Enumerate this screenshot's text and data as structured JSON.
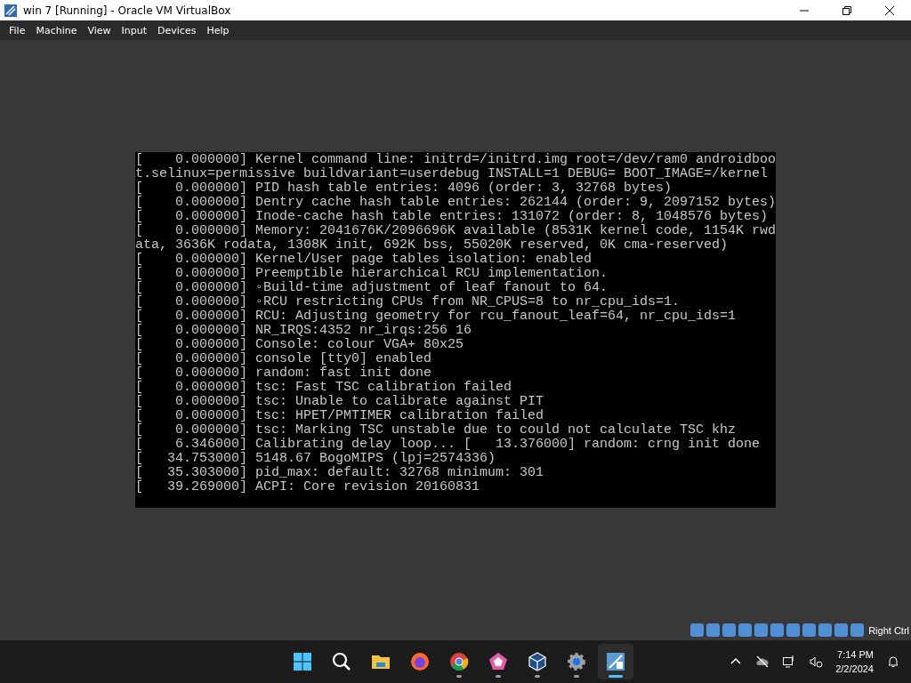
{
  "window": {
    "title": "win 7 [Running] - Oracle VM VirtualBox"
  },
  "menu": [
    "File",
    "Machine",
    "View",
    "Input",
    "Devices",
    "Help"
  ],
  "console": {
    "lines": [
      "[    0.000000] Kernel command line: initrd=/initrd.img root=/dev/ram0 androidboo",
      "t.selinux=permissive buildvariant=userdebug INSTALL=1 DEBUG= BOOT_IMAGE=/kernel",
      "[    0.000000] PID hash table entries: 4096 (order: 3, 32768 bytes)",
      "[    0.000000] Dentry cache hash table entries: 262144 (order: 9, 2097152 bytes)",
      "[    0.000000] Inode-cache hash table entries: 131072 (order: 8, 1048576 bytes)",
      "[    0.000000] Memory: 2041676K/2096696K available (8531K kernel code, 1154K rwd",
      "ata, 3636K rodata, 1308K init, 692K bss, 55020K reserved, 0K cma-reserved)",
      "[    0.000000] Kernel/User page tables isolation: enabled",
      "[    0.000000] Preemptible hierarchical RCU implementation.",
      "[    0.000000] ◦Build-time adjustment of leaf fanout to 64.",
      "[    0.000000] ◦RCU restricting CPUs from NR_CPUS=8 to nr_cpu_ids=1.",
      "[    0.000000] RCU: Adjusting geometry for rcu_fanout_leaf=64, nr_cpu_ids=1",
      "[    0.000000] NR_IRQS:4352 nr_irqs:256 16",
      "[    0.000000] Console: colour VGA+ 80x25",
      "[    0.000000] console [tty0] enabled",
      "[    0.000000] random: fast init done",
      "[    0.000000] tsc: Fast TSC calibration failed",
      "[    0.000000] tsc: Unable to calibrate against PIT",
      "[    0.000000] tsc: HPET/PMTIMER calibration failed",
      "[    0.000000] tsc: Marking TSC unstable due to could not calculate TSC khz",
      "[    6.346000] Calibrating delay loop... [   13.376000] random: crng init done",
      "[   34.753000] 5148.67 BogoMIPS (lpj=2574336)",
      "[   35.303000] pid_max: default: 32768 minimum: 301",
      "[   39.269000] ACPI: Core revision 20160831"
    ]
  },
  "status_bar": {
    "host_key": "Right Ctrl"
  },
  "taskbar": {
    "apps": [
      {
        "kind": "start",
        "running": false,
        "selected": false
      },
      {
        "kind": "search",
        "running": false,
        "selected": false
      },
      {
        "kind": "folder",
        "running": false,
        "selected": false
      },
      {
        "kind": "firefox",
        "running": false,
        "selected": false
      },
      {
        "kind": "chrome",
        "running": true,
        "selected": false
      },
      {
        "kind": "pentagon",
        "running": true,
        "selected": false
      },
      {
        "kind": "cube",
        "running": true,
        "selected": false
      },
      {
        "kind": "gear",
        "running": true,
        "selected": false
      },
      {
        "kind": "vm",
        "running": true,
        "selected": true
      }
    ],
    "time": "7:14 PM",
    "date": "2/2/2024"
  }
}
